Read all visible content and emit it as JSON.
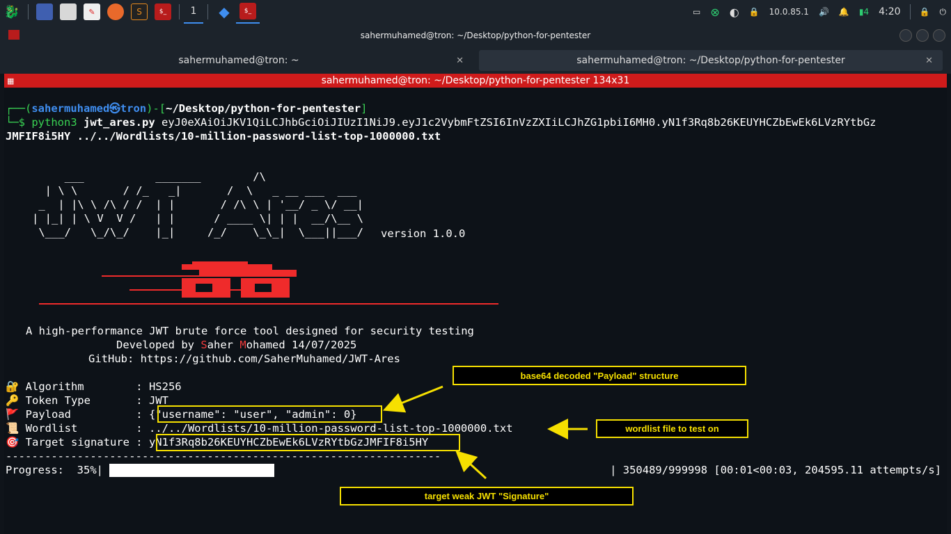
{
  "taskbar": {
    "workspace": "1",
    "tray": {
      "ip": "10.0.85.1",
      "battery": "4",
      "time": "4:20"
    }
  },
  "window": {
    "title": "sahermuhamed@tron: ~/Desktop/python-for-pentester",
    "tabs": [
      {
        "label": "sahermuhamed@tron: ~"
      },
      {
        "label": "sahermuhamed@tron: ~/Desktop/python-for-pentester"
      }
    ],
    "terminal_header": "sahermuhamed@tron: ~/Desktop/python-for-pentester 134x31"
  },
  "terminal": {
    "prompt": {
      "open": "┌──(",
      "user_host": "sahermuhamed㉿tron",
      "close": ")-[",
      "path": "~/Desktop/python-for-pentester",
      "end": "]",
      "cmd_prefix": "└─$ ",
      "cmd_name": "python3",
      "script": "jwt_ares.py",
      "arg_token": " eyJ0eXAiOiJKV1QiLCJhbGciOiJIUzI1NiJ9.eyJ1c2VybmFtZSI6InVzZXIiLCJhZG1pbiI6MH0.yN1f3Rq8b26KEUYHCZbEwEk6LVzRYtbGz",
      "arg_cont": "JMFIF8i5HY ../../Wordlists/10-million-password-list-top-1000000.txt"
    },
    "version": "version 1.0.0",
    "tagline": "A high-performance JWT brute force tool designed for security testing",
    "developed_prefix": "Developed by ",
    "developed_S": "S",
    "developed_aher": "aher ",
    "developed_M": "M",
    "developed_rest": "ohamed 14/07/2025",
    "github": "GitHub: https://github.com/SaherMuhamed/JWT-Ares",
    "info": [
      {
        "icon": "🔐",
        "label": "Algorithm        : ",
        "value": "HS256"
      },
      {
        "icon": "🔑",
        "label": "Token Type       : ",
        "value": "JWT"
      },
      {
        "icon": "🚩",
        "label": "Payload          : ",
        "value": "{\"username\": \"user\", \"admin\": 0}"
      },
      {
        "icon": "📜",
        "label": "Wordlist         : ",
        "value": "../../Wordlists/10-million-password-list-top-1000000.txt"
      },
      {
        "icon": "🎯",
        "label": "Target signature : ",
        "value": "yN1f3Rq8b26KEUYHCZbEwEk6LVzRYtbGzJMFIF8i5HY"
      }
    ],
    "divider": "-------------------------------------------------------------------",
    "progress": {
      "label": "Progress:  35%|",
      "percent": 35,
      "stats": "| 350489/999998 [00:01<00:03, 204595.11 attempts/s]"
    }
  },
  "annotations": {
    "payload_note": "base64 decoded \"Payload\" structure",
    "wordlist_note": "wordlist file to test on",
    "signature_note": "target weak JWT \"Signature\""
  }
}
